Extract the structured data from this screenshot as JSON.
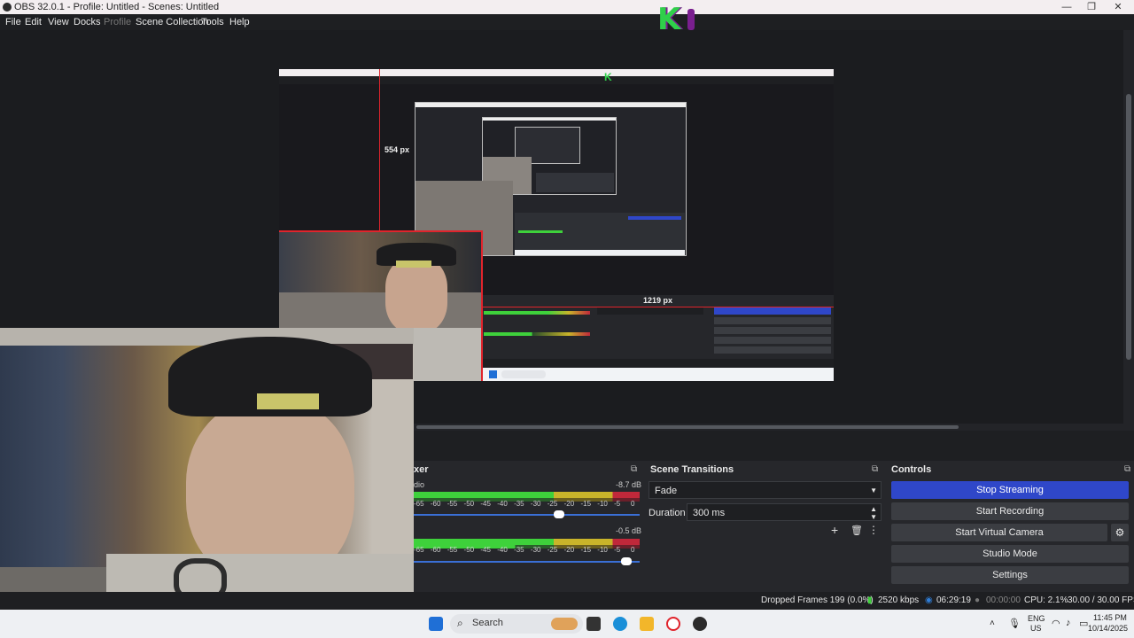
{
  "window": {
    "title": "OBS 32.0.1 - Profile: Untitled - Scenes: Untitled",
    "controls": {
      "minimize": "—",
      "maximize": "❐",
      "close": "✕"
    }
  },
  "menu": {
    "items": [
      "File",
      "Edit",
      "View",
      "Docks",
      "Profile",
      "Scene Collection",
      "Tools",
      "Help"
    ]
  },
  "overlay": {
    "logo_text": "K"
  },
  "preview": {
    "selection_height_label": "554 px",
    "selection_width_label": "1219 px"
  },
  "mixer": {
    "header": "xer",
    "channel1": {
      "name": "dio",
      "db": "-8.7 dB"
    },
    "channel2": {
      "db": "-0.5 dB"
    },
    "scale": [
      "-65",
      "-60",
      "-55",
      "-50",
      "-45",
      "-40",
      "-35",
      "-30",
      "-25",
      "-20",
      "-15",
      "-10",
      "-5",
      "0"
    ]
  },
  "transitions": {
    "header": "Scene Transitions",
    "selected": "Fade",
    "duration_label": "Duration",
    "duration_value": "300 ms"
  },
  "controls": {
    "header": "Controls",
    "stop_streaming": "Stop Streaming",
    "start_recording": "Start Recording",
    "start_virtual_camera": "Start Virtual Camera",
    "studio_mode": "Studio Mode",
    "settings": "Settings"
  },
  "status": {
    "dropped_frames": "Dropped Frames 199 (0.0%)",
    "bitrate": "2520 kbps",
    "stream_time": "06:29:19",
    "record_time": "00:00:00",
    "cpu": "CPU: 2.1%",
    "fps": "30.00 / 30.00 FPS"
  },
  "taskbar": {
    "search_placeholder": "Search",
    "lang_top": "ENG",
    "lang_bottom": "US",
    "time": "11:45 PM",
    "date": "10/14/2025"
  },
  "colors": {
    "accent_blue": "#2f47c9",
    "selection_red": "#e0242c",
    "meter_green": "#3ed13b",
    "meter_yellow": "#c9b42a",
    "meter_red": "#c0283a"
  }
}
